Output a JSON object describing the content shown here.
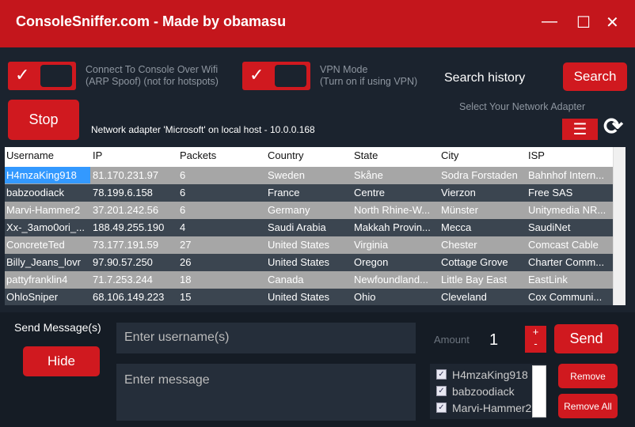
{
  "window": {
    "title": "ConsoleSniffer.com - Made by obamasu",
    "minimize": "—",
    "maximize": "☐",
    "close": "✕"
  },
  "toolbar": {
    "wifi_toggle": {
      "checked": true,
      "label1": "Connect To Console Over Wifi",
      "label2": "(ARP Spoof) (not for hotspots)"
    },
    "vpn_toggle": {
      "checked": true,
      "label1": "VPN Mode",
      "label2": "(Turn on if using VPN)"
    },
    "check": "✓",
    "search_history": "Search history",
    "search_label": "Search",
    "stop_label": "Stop",
    "adapter_text": "Network adapter 'Microsoft' on local host - 10.0.0.168",
    "select_adapter": "Select Your Network Adapter",
    "menu_icon": "☰",
    "refresh_icon": "⟳"
  },
  "table": {
    "columns": [
      "Username",
      "IP",
      "Packets",
      "Country",
      "State",
      "City",
      "ISP"
    ],
    "rows": [
      [
        "H4mzaKing918",
        "81.170.231.97",
        "6",
        "Sweden",
        "Skåne",
        "Sodra Forstaden",
        "Bahnhof Intern..."
      ],
      [
        "babzoodiack",
        "78.199.6.158",
        "6",
        "France",
        "Centre",
        "Vierzon",
        "Free SAS"
      ],
      [
        "Marvi-Hammer2",
        "37.201.242.56",
        "6",
        "Germany",
        "North Rhine-W...",
        "Münster",
        "Unitymedia NR..."
      ],
      [
        "Xx-_3amo0ori_...",
        "188.49.255.190",
        "4",
        "Saudi Arabia",
        "Makkah Provin...",
        "Mecca",
        "SaudiNet"
      ],
      [
        "ConcreteTed",
        "73.177.191.59",
        "27",
        "United States",
        "Virginia",
        "Chester",
        "Comcast Cable"
      ],
      [
        "Billy_Jeans_lovr",
        "97.90.57.250",
        "26",
        "United States",
        "Oregon",
        "Cottage Grove",
        "Charter Comm..."
      ],
      [
        "pattyfranklin4",
        "71.7.253.244",
        "18",
        "Canada",
        "Newfoundland...",
        "Little Bay East",
        "EastLink"
      ],
      [
        "OhloSniper",
        "68.106.149.223",
        "15",
        "United States",
        "Ohio",
        "Cleveland",
        "Cox Communi..."
      ]
    ]
  },
  "message": {
    "section_label": "Send Message(s)",
    "hide_label": "Hide",
    "username_placeholder": "Enter username(s)",
    "message_placeholder": "Enter message",
    "amount_label": "Amount",
    "amount_value": "1",
    "plus": "+",
    "minus": "-",
    "send_label": "Send",
    "recipients": [
      "H4mzaKing918",
      "babzoodiack",
      "Marvi-Hammer2"
    ],
    "remove_label": "Remove",
    "remove_all_label": "Remove All"
  },
  "colors": {
    "accent": "#c4161c",
    "background": "#1b232e",
    "selected": "#3399ff"
  }
}
